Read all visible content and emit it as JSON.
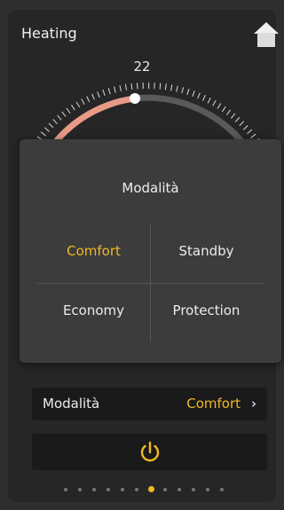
{
  "header": {
    "title": "Heating"
  },
  "dial": {
    "setpoint": "22"
  },
  "popup": {
    "title": "Modalità",
    "options": [
      "Comfort",
      "Standby",
      "Economy",
      "Protection"
    ],
    "selected": "Comfort"
  },
  "mode_row": {
    "label": "Modalità",
    "value": "Comfort",
    "chevron": "›"
  },
  "power": {
    "icon": "power-icon"
  },
  "pager": {
    "count": 12,
    "active_index": 6
  },
  "colors": {
    "accent": "#f2b824",
    "dial_active": "#e89a86",
    "dial_track": "#5a5a5a"
  }
}
